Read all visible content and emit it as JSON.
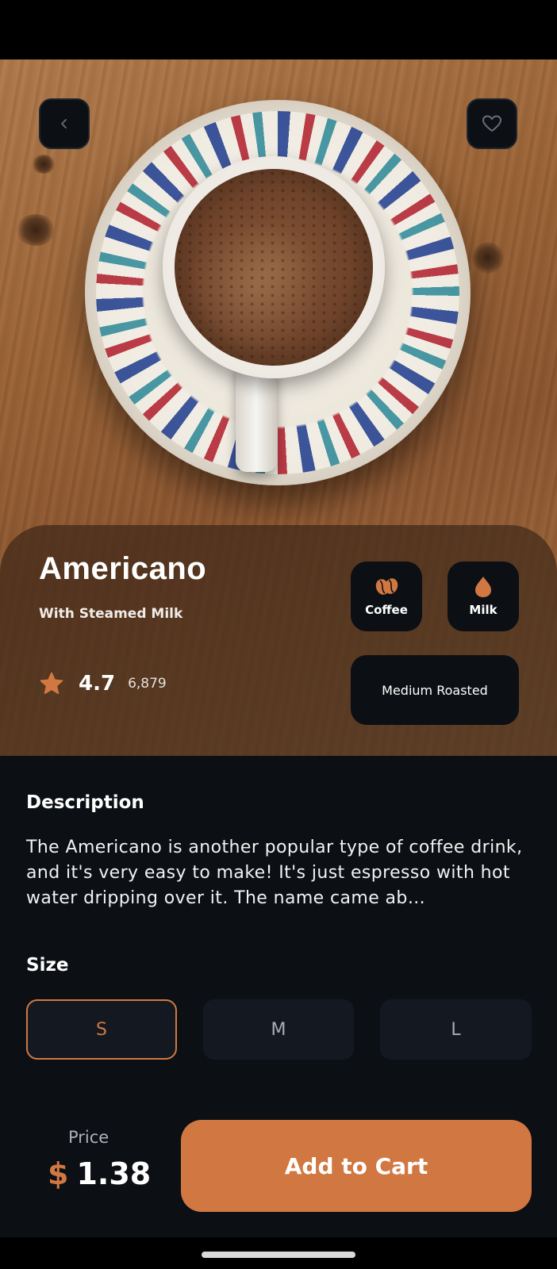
{
  "product": {
    "name": "Americano",
    "subtitle": "With Steamed Milk",
    "rating": "4.7",
    "rating_count": "6,879",
    "chips": {
      "coffee_label": "Coffee",
      "milk_label": "Milk",
      "roast_label": "Medium Roasted"
    }
  },
  "description": {
    "title": "Description",
    "text": "The Americano is another popular type of coffee drink, and it's very easy to make! It's just espresso with hot water dripping over it. The name came ab…"
  },
  "size": {
    "title": "Size",
    "options": [
      "S",
      "M",
      "L"
    ],
    "selected": "S"
  },
  "price": {
    "label": "Price",
    "currency": "$",
    "amount": "1.38"
  },
  "cart_button_label": "Add to Cart",
  "icons": {
    "back": "chevron-left-icon",
    "favorite": "heart-icon",
    "rating": "star-icon",
    "coffee": "coffee-beans-icon",
    "milk": "milk-drop-icon"
  },
  "colors": {
    "accent": "#D17842",
    "background": "#0C0F14",
    "card": "#141921",
    "muted_text": "#AEB2B8"
  }
}
